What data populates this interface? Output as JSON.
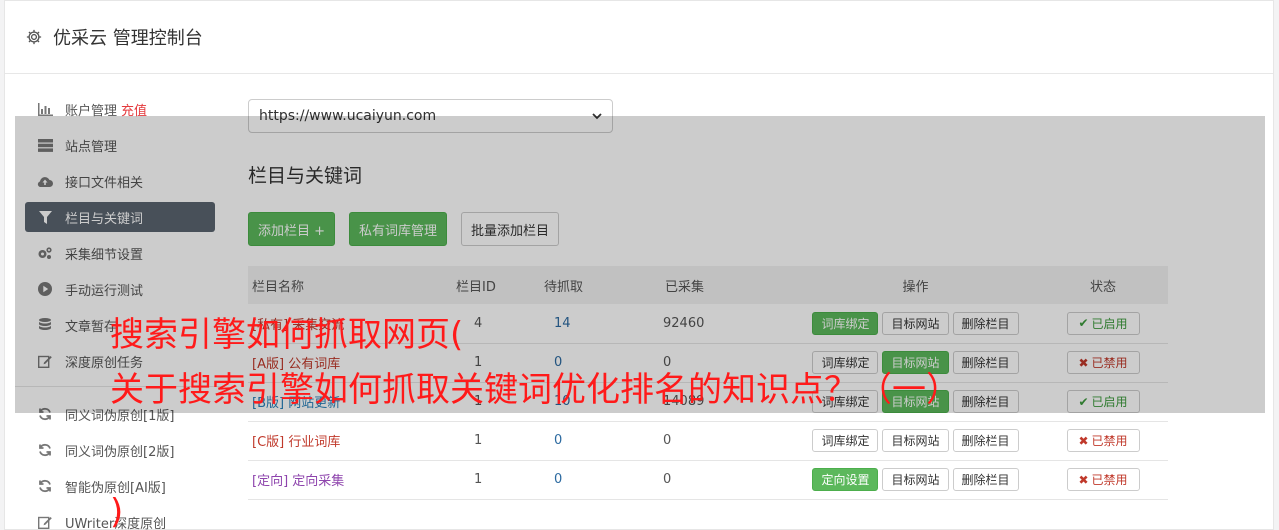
{
  "header": {
    "title": "优采云 管理控制台",
    "icon": "gear-icon"
  },
  "sidebar": {
    "recharge": "充值",
    "items": [
      {
        "label": "账户管理",
        "icon": "bar-chart-icon"
      },
      {
        "label": "站点管理",
        "icon": "server-icon"
      },
      {
        "label": "接口文件相关",
        "icon": "cloud-upload-icon"
      },
      {
        "label": "栏目与关键词",
        "icon": "filter-icon",
        "active": true
      },
      {
        "label": "采集细节设置",
        "icon": "cogs-icon"
      },
      {
        "label": "手动运行测试",
        "icon": "play-circle-icon"
      },
      {
        "label": "文章暂存",
        "icon": "database-icon"
      },
      {
        "label": "深度原创任务",
        "icon": "edit-icon"
      },
      {
        "label": "同义词伪原创[1版]",
        "icon": "refresh-icon"
      },
      {
        "label": "同义词伪原创[2版]",
        "icon": "refresh-icon"
      },
      {
        "label": "智能伪原创[AI版]",
        "icon": "refresh-icon"
      },
      {
        "label": "UWriter深度原创",
        "icon": "edit-icon"
      }
    ]
  },
  "main": {
    "site_select": "https://www.ucaiyun.com",
    "section_title": "栏目与关键词",
    "toolbar": {
      "add_column": "添加栏目 +",
      "private_lexicon": "私有词库管理",
      "batch_add": "批量添加栏目"
    },
    "table": {
      "headers": [
        "栏目名称",
        "栏目ID",
        "待抓取",
        "已采集",
        "操作",
        "状态"
      ],
      "rows": [
        {
          "tag": "[私有]",
          "name": "采集交流",
          "id": "4",
          "pending": "14",
          "collected": "92460",
          "op1": "词库绑定",
          "op2": "目标网站",
          "op3": "删除栏目",
          "status": "已启用"
        },
        {
          "tag": "[A版]",
          "name": "公有词库",
          "id": "1",
          "pending": "0",
          "collected": "0",
          "op1": "词库绑定",
          "op2": "目标网站",
          "op3": "删除栏目",
          "status": "已禁用"
        },
        {
          "tag": "[B版]",
          "name": "网站更新",
          "id": "1",
          "pending": "10",
          "collected": "14089",
          "op1": "词库绑定",
          "op2": "目标网站",
          "op3": "删除栏目",
          "status": "已启用"
        },
        {
          "tag": "[C版]",
          "name": "行业词库",
          "id": "1",
          "pending": "0",
          "collected": "0",
          "op1": "词库绑定",
          "op2": "目标网站",
          "op3": "删除栏目",
          "status": "已禁用"
        },
        {
          "tag": "[定向]",
          "name": "定向采集",
          "id": "1",
          "pending": "0",
          "collected": "0",
          "op1": "定向设置",
          "op2": "目标网站",
          "op3": "删除栏目",
          "status": "已禁用"
        }
      ]
    }
  },
  "watermark": {
    "line1": "搜索引擎如何抓取网页(",
    "line2": "关于搜索引擎如何抓取关键词优化排名的知识点？（一）",
    "line3": ")"
  }
}
